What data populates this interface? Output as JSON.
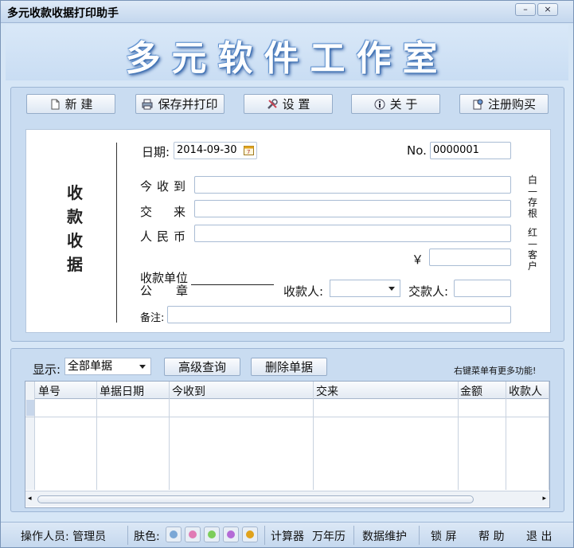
{
  "window": {
    "title": "多元收款收据打印助手",
    "min_label": "–",
    "close_label": "×"
  },
  "banner": {
    "text": "多元软件工作室"
  },
  "toolbar": {
    "new_label": "新 建",
    "save_print_label": "保存并打印",
    "settings_label": "设 置",
    "about_label": "关 于",
    "register_label": "注册购买"
  },
  "receipt": {
    "title": "收款收据",
    "date_label": "日期:",
    "date_value": "2014-09-30",
    "no_label": "No.",
    "no_value": "0000001",
    "received_from_label": "今收到",
    "received_from_value": "",
    "payment_for_label": "交　来",
    "payment_for_value": "",
    "rmb_label": "人民币",
    "rmb_value": "",
    "yen_label": "￥",
    "amount_value": "",
    "unit_seal_label": "收款单位\n公　　章",
    "receiver_label": "收款人:",
    "receiver_value": "",
    "payer_label": "交款人:",
    "payer_value": "",
    "remarks_label": "备注:",
    "remarks_value": "",
    "side_white": "白—存根",
    "side_red": "红—客户"
  },
  "list": {
    "show_label": "显示:",
    "filter_value": "全部单据",
    "advanced_search_label": "高级查询",
    "delete_label": "删除单据",
    "hint": "右键菜单有更多功能!",
    "columns": [
      "单号",
      "单据日期",
      "今收到",
      "交来",
      "金额",
      "收款人"
    ],
    "rows": []
  },
  "statusbar": {
    "operator_label": "操作人员: 管理员",
    "skin_label": "肤色:",
    "skins": [
      {
        "name": "blue",
        "color": "#7aa7d6"
      },
      {
        "name": "pink",
        "color": "#e07bb5"
      },
      {
        "name": "green",
        "color": "#7ccd5a"
      },
      {
        "name": "purple",
        "color": "#b46ad6"
      },
      {
        "name": "orange",
        "color": "#e0a21c"
      }
    ],
    "calculator_label": "计算器",
    "calendar_label": "万年历",
    "data_maint_label": "数据维护",
    "lock_label": "锁 屏",
    "help_label": "帮 助",
    "exit_label": "退 出"
  }
}
